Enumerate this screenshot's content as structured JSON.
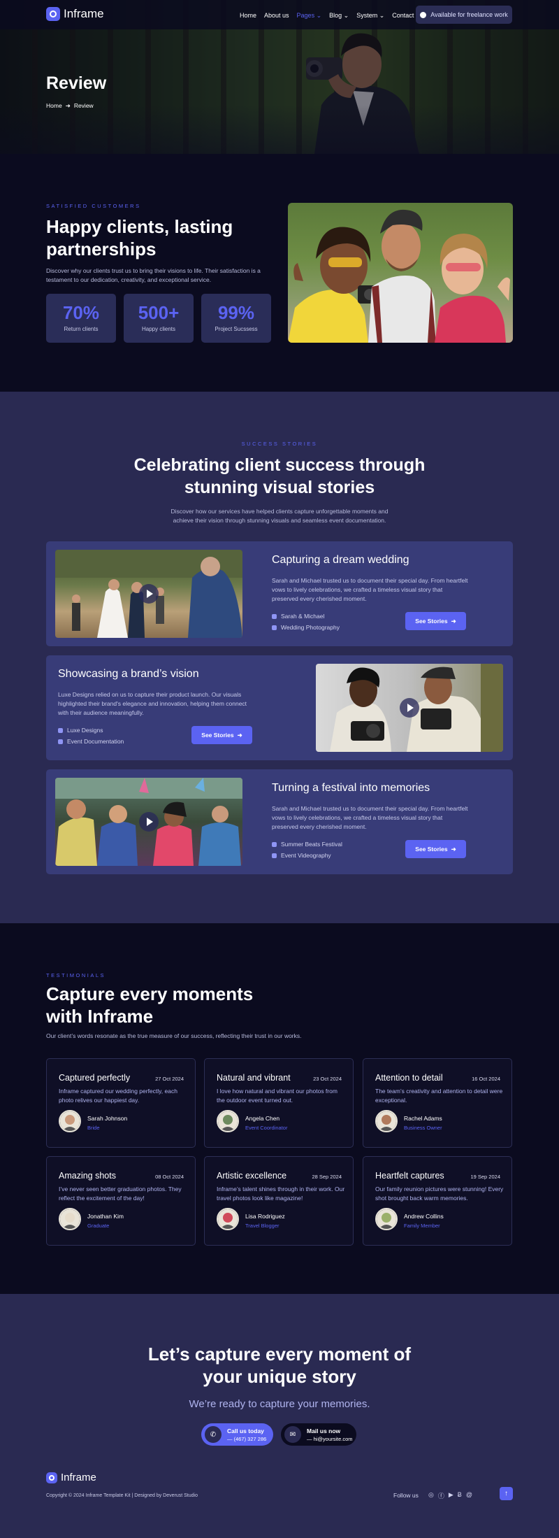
{
  "brand": {
    "name": "Inframe"
  },
  "nav": {
    "items": [
      "Home",
      "About us",
      "Pages",
      "Blog",
      "System",
      "Contact us"
    ],
    "active": "Pages",
    "cta": "Available for freelance work"
  },
  "hero": {
    "title": "Review",
    "breadcrumb": [
      "Home",
      "Review"
    ]
  },
  "satisfied": {
    "kicker": "SATISFIED CUSTOMERS",
    "title_line1": "Happy clients, lasting",
    "title_line2": "partnerships",
    "text": "Discover why our clients trust us to bring their visions to life. Their satisfaction is a testament to our dedication, creativity, and exceptional service.",
    "stats": [
      {
        "value": "70%",
        "label": "Return clients"
      },
      {
        "value": "500+",
        "label": "Happy clients"
      },
      {
        "value": "99%",
        "label": "Project Sucssess"
      }
    ]
  },
  "stories": {
    "kicker": "SUCCESS STORIES",
    "title_line1": "Celebrating client success through",
    "title_line2": "stunning visual stories",
    "text": "Discover how our services have helped clients capture unforgettable moments and achieve their vision through stunning visuals and seamless event documentation.",
    "items": [
      {
        "title": "Capturing a dream wedding",
        "text": "Sarah and Michael trusted us to document their special day. From heartfelt vows to lively celebrations, we crafted a timeless visual story that preserved every cherished moment.",
        "client": "Sarah & Michael",
        "service": "Wedding Photography",
        "button": "See Stories"
      },
      {
        "title": "Showcasing a brand’s vision",
        "text": "Luxe Designs relied on us to capture their product launch. Our visuals highlighted their brand's elegance and innovation, helping them connect with their audience meaningfully.",
        "client": "Luxe Designs",
        "service": "Event Documentation",
        "button": "See Stories"
      },
      {
        "title": "Turning a festival into memories",
        "text": "Sarah and Michael trusted us to document their special day. From heartfelt vows to lively celebrations, we crafted a timeless visual story that preserved every cherished moment.",
        "client": "Summer Beats Festival",
        "service": "Event Videography",
        "button": "See Stories"
      }
    ]
  },
  "testimonials": {
    "kicker": "TESTIMONIALS",
    "title_line1": "Capture every moments",
    "title_line2": "with Inframe",
    "text": "Our client’s words resonate as the true measure of our success, reflecting their trust in our works.",
    "cards": [
      {
        "title": "Captured perfectly",
        "date": "27 Oct 2024",
        "text": "Inframe captured our wedding perfectly, each photo relives our happiest day.",
        "name": "Sarah Johnson",
        "role": "Bride",
        "avatar": "#c99a7c"
      },
      {
        "title": "Natural and vibrant",
        "date": "23 Oct 2024",
        "text": "I love how natural and vibrant our photos from the outdoor event turned out.",
        "name": "Angela Chen",
        "role": "Event Coordinator",
        "avatar": "#6d8a5e"
      },
      {
        "title": "Attention to detail",
        "date": "16 Oct 2024",
        "text": "The team’s creativity and attention to detail were exceptional.",
        "name": "Rachel Adams",
        "role": "Business Owner",
        "avatar": "#b07a5c"
      },
      {
        "title": "Amazing shots",
        "date": "08 Oct 2024",
        "text": "I’ve never seen better graduation photos. They reflect the excitement of the day!",
        "name": "Jonathan Kim",
        "role": "Graduate",
        "avatar": "#e6dccb"
      },
      {
        "title": "Artistic excellence",
        "date": "28 Sep 2024",
        "text": "Inframe’s talent shines through in their work. Our travel photos look like magazine!",
        "name": "Lisa Rodriguez",
        "role": "Travel Blogger",
        "avatar": "#d04a5a"
      },
      {
        "title": "Heartfelt captures",
        "date": "19 Sep 2024",
        "text": "Our family reunion pictures were stunning! Every shot brought back warm memories.",
        "name": "Andrew Collins",
        "role": "Family Member",
        "avatar": "#9bb06a"
      }
    ]
  },
  "cta": {
    "title_line1": "Let’s capture every moment of",
    "title_line2": "your unique story",
    "subtitle": "We’re ready to capture your memories.",
    "call_label": "Call us today",
    "call_value": "— (467) 327 286",
    "mail_label": "Mail us now",
    "mail_value": "— hi@yoursite.com"
  },
  "footer": {
    "copyright": "Copyright © 2024 Inframe Template Kit | Designed by Deverust Studio",
    "follow": "Follow us"
  }
}
